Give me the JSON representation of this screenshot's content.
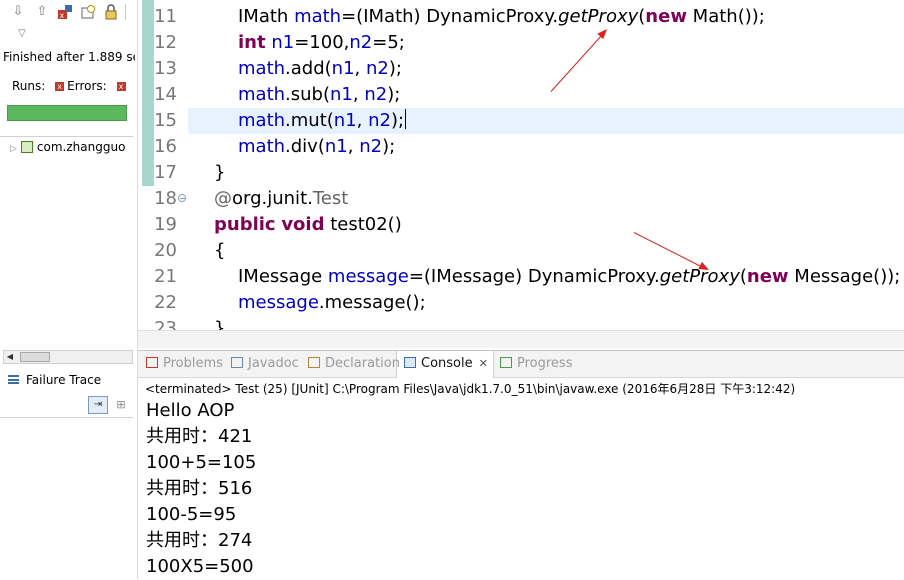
{
  "left_panel": {
    "toolbar_icons": [
      "arrow-down-icon",
      "arrow-up-icon",
      "failures-filter-icon",
      "history-icon",
      "lock-icon",
      "view-menu-icon"
    ],
    "finished_text": "Finished after 1.889 se",
    "runs_label": "Runs:",
    "errors_label": "Errors:",
    "progress_color": "#5cb85c",
    "tree_item_label": "com.zhangguo",
    "failure_trace_label": "Failure Trace"
  },
  "editor": {
    "lines": [
      {
        "num": "11",
        "tokens": [
          [
            "",
            "IMath "
          ],
          [
            "fld",
            "math"
          ],
          [
            "",
            "=(IMath) DynamicProxy."
          ],
          [
            "it",
            "getProxy"
          ],
          [
            "",
            "("
          ],
          [
            "kw",
            "new"
          ],
          [
            "",
            " Math());"
          ]
        ]
      },
      {
        "num": "12",
        "tokens": [
          [
            "kw",
            "int"
          ],
          [
            "",
            " "
          ],
          [
            "fld",
            "n1"
          ],
          [
            "",
            "=100,"
          ],
          [
            "fld",
            "n2"
          ],
          [
            "",
            "=5;"
          ]
        ]
      },
      {
        "num": "13",
        "tokens": [
          [
            "fld",
            "math"
          ],
          [
            "",
            ".add("
          ],
          [
            "fld",
            "n1"
          ],
          [
            "",
            ", "
          ],
          [
            "fld",
            "n2"
          ],
          [
            "",
            ");"
          ]
        ]
      },
      {
        "num": "14",
        "tokens": [
          [
            "fld",
            "math"
          ],
          [
            "",
            ".sub("
          ],
          [
            "fld",
            "n1"
          ],
          [
            "",
            ", "
          ],
          [
            "fld",
            "n2"
          ],
          [
            "",
            ");"
          ]
        ]
      },
      {
        "num": "15",
        "tokens": [
          [
            "fld",
            "math"
          ],
          [
            "",
            ".mut("
          ],
          [
            "fld",
            "n1"
          ],
          [
            "",
            ", "
          ],
          [
            "fld",
            "n2"
          ],
          [
            "",
            ");"
          ]
        ]
      },
      {
        "num": "16",
        "tokens": [
          [
            "fld",
            "math"
          ],
          [
            "",
            ".div("
          ],
          [
            "fld",
            "n1"
          ],
          [
            "",
            ", "
          ],
          [
            "fld",
            "n2"
          ],
          [
            "",
            ");"
          ]
        ]
      },
      {
        "num": "17",
        "tokens": [
          [
            "",
            "}"
          ]
        ]
      },
      {
        "num": "18",
        "tokens": [
          [
            "ann",
            "@"
          ],
          [
            "",
            "org.junit."
          ],
          [
            "ann",
            "Test"
          ]
        ]
      },
      {
        "num": "19",
        "tokens": [
          [
            "kw",
            "public"
          ],
          [
            "",
            " "
          ],
          [
            "kw",
            "void"
          ],
          [
            "",
            " test02()"
          ]
        ]
      },
      {
        "num": "20",
        "tokens": [
          [
            "",
            "{"
          ]
        ]
      },
      {
        "num": "21",
        "tokens": [
          [
            "",
            "IMessage "
          ],
          [
            "fld",
            "message"
          ],
          [
            "",
            "=(IMessage) DynamicProxy."
          ],
          [
            "it",
            "getProxy"
          ],
          [
            "",
            "("
          ],
          [
            "kw",
            "new"
          ],
          [
            "",
            " Message());"
          ]
        ]
      },
      {
        "num": "22",
        "tokens": [
          [
            "fld",
            "message"
          ],
          [
            "",
            ".message();"
          ]
        ]
      },
      {
        "num": "23",
        "tokens": [
          [
            "",
            "}"
          ]
        ]
      }
    ],
    "arrow_color": "#e0201c",
    "keyword_color": "#7f0055",
    "field_color": "#0000c0"
  },
  "bottom_panel": {
    "tabs": [
      {
        "label": "Problems",
        "icon": "problems-icon"
      },
      {
        "label": "Javadoc",
        "icon": "javadoc-icon"
      },
      {
        "label": "Declaration",
        "icon": "declaration-icon"
      },
      {
        "label": "Console",
        "icon": "console-icon",
        "active": true
      },
      {
        "label": "Progress",
        "icon": "progress-icon"
      }
    ],
    "close_glyph": "✕",
    "terminated_line": "<terminated> Test (25) [JUnit] C:\\Program Files\\Java\\jdk1.7.0_51\\bin\\javaw.exe (2016年6月28日 下午3:12:42)",
    "output": [
      "Hello AOP",
      "共用时：421",
      "100+5=105",
      "共用时：516",
      "100-5=95",
      "共用时：274",
      "100X5=500"
    ]
  }
}
